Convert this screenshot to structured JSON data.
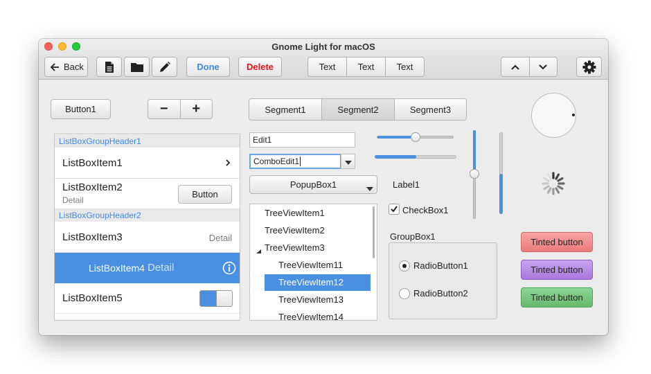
{
  "window": {
    "title": "Gnome Light for macOS"
  },
  "toolbar": {
    "back_label": "Back",
    "done_label": "Done",
    "delete_label": "Delete",
    "text_tabs": [
      "Text",
      "Text",
      "Text"
    ],
    "done_color": "#3d8ae0",
    "delete_color": "#e8141e"
  },
  "controls": {
    "button1": "Button1",
    "minus": "−",
    "plus": "+",
    "segments": [
      "Segment1",
      "Segment2",
      "Segment3"
    ],
    "selected_segment": "Segment2"
  },
  "listbox": {
    "header1": "ListBoxGroupHeader1",
    "header2": "ListBoxGroupHeader2",
    "item1": "ListBoxItem1",
    "item2": "ListBoxItem2",
    "item2_detail": "Detail",
    "item2_button": "Button",
    "item3": "ListBoxItem3",
    "item3_detail": "Detail",
    "item4": "ListBoxItem4",
    "item4_detail": "Detail",
    "item5": "ListBoxItem5",
    "selected_color": "#4a90e2",
    "item5_switch_on": true
  },
  "inputs": {
    "edit1": "Edit1",
    "combo1": "ComboEdit1",
    "popup1": "PopupBox1",
    "label1": "Label1",
    "checkbox1": "CheckBox1",
    "checkbox1_checked": true
  },
  "sliders": {
    "h1_value": 0.5,
    "progress_value": 0.5,
    "v1_value": 0.5,
    "v2_value": 0.5
  },
  "tree": {
    "items": [
      "TreeViewItem1",
      "TreeViewItem2",
      "TreeViewItem3",
      "TreeViewItem11",
      "TreeViewItem12",
      "TreeViewItem13",
      "TreeViewItem14"
    ],
    "selected": "TreeViewItem12"
  },
  "groupbox": {
    "title": "GroupBox1",
    "radio1": "RadioButton1",
    "radio2": "RadioButton2",
    "radio1_checked": true
  },
  "tinted": {
    "red_label": "Tinted button",
    "purple_label": "Tinted button",
    "green_label": "Tinted button",
    "red_color": "#f28b8b",
    "purple_color": "#b68ae3",
    "green_color": "#79c77f"
  },
  "icons": [
    "arrow-left-icon",
    "document-icon",
    "folder-icon",
    "pencil-icon",
    "chevron-up-icon",
    "chevron-down-icon",
    "gear-icon",
    "info-icon",
    "chevron-right-icon",
    "spinner-icon",
    "checkmark-icon"
  ]
}
